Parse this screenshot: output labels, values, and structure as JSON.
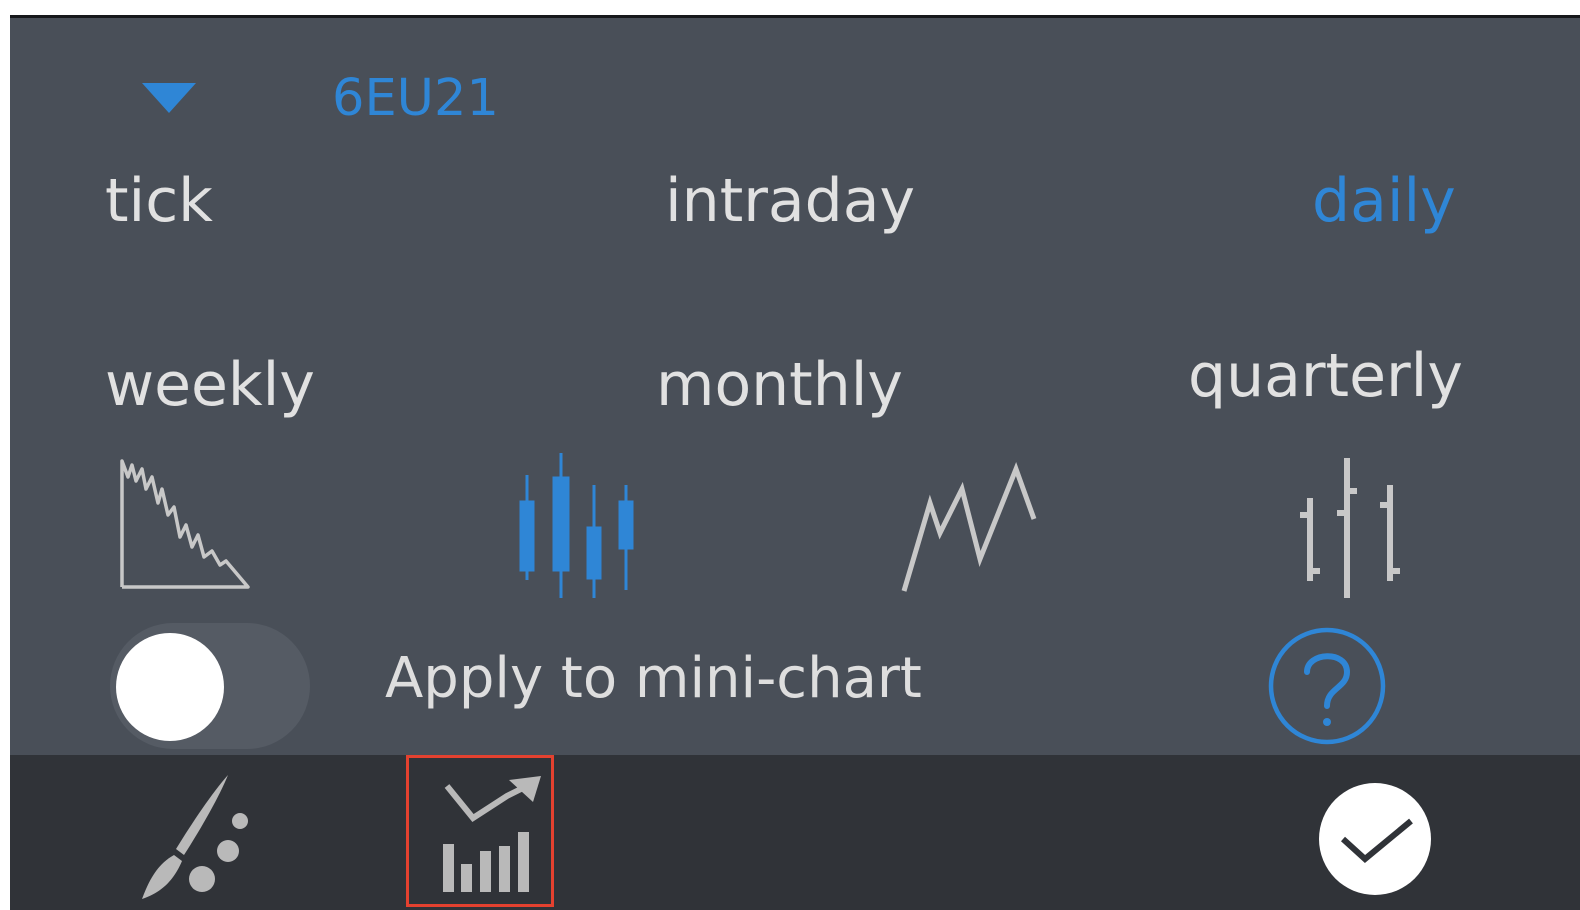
{
  "symbol": {
    "label": "6EU21",
    "dropdown_icon": "triangle-down-icon"
  },
  "periods": [
    {
      "label": "tick",
      "active": false
    },
    {
      "label": "intraday",
      "active": false
    },
    {
      "label": "daily",
      "active": true
    },
    {
      "label": "weekly",
      "active": false
    },
    {
      "label": "monthly",
      "active": false
    },
    {
      "label": "quarterly",
      "active": false
    }
  ],
  "chart_types": [
    {
      "icon": "area-chart-icon",
      "active": false
    },
    {
      "icon": "candlestick-chart-icon",
      "active": true
    },
    {
      "icon": "line-chart-icon",
      "active": false
    },
    {
      "icon": "ohlc-bar-chart-icon",
      "active": false
    }
  ],
  "mini_chart": {
    "label": "Apply to mini-chart",
    "enabled": false
  },
  "help_icon": "question-circle-icon",
  "bottom_bar": {
    "brush_icon": "paintbrush-icon",
    "chart_settings_icon": "bar-chart-trend-icon",
    "confirm_icon": "checkmark-circle-icon"
  },
  "colors": {
    "panel_bg": "#494f58",
    "bottom_bar_bg": "#303338",
    "accent_blue": "#2f86d6",
    "text_light": "#e1e1e1",
    "icon_gray": "#c8c8c8",
    "highlight_red": "#e4412f"
  }
}
